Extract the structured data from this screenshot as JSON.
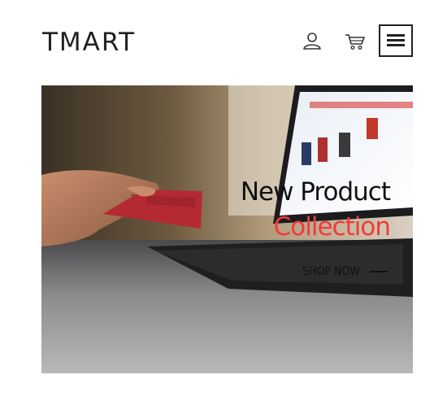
{
  "header": {
    "logo": "TMART",
    "icons": {
      "user": "user-icon",
      "cart": "cart-icon",
      "menu": "hamburger-menu-icon"
    }
  },
  "hero": {
    "title_line1": "New Product",
    "title_line2": "Collection",
    "cta_label": "SHOP NOW",
    "accent_color": "#f03b3b"
  }
}
